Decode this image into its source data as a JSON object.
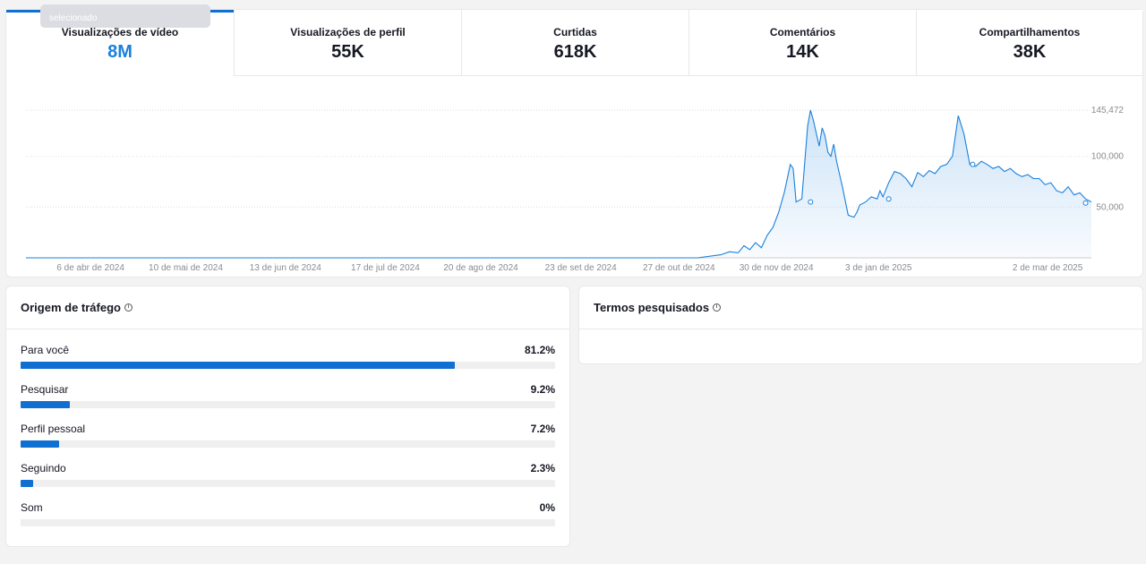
{
  "tooltip_fragment": "selecionado",
  "metrics": [
    {
      "label": "Visualizações de vídeo",
      "value": "8M",
      "active": true
    },
    {
      "label": "Visualizações de perfil",
      "value": "55K",
      "active": false
    },
    {
      "label": "Curtidas",
      "value": "618K",
      "active": false
    },
    {
      "label": "Comentários",
      "value": "14K",
      "active": false
    },
    {
      "label": "Compartilhamentos",
      "value": "38K",
      "active": false
    }
  ],
  "chart_data": {
    "type": "area",
    "title": "",
    "y_ticks": [
      145472,
      100000,
      50000
    ],
    "y_tick_labels": [
      "145,472",
      "100,000",
      "50,000"
    ],
    "ylim": [
      0,
      145472
    ],
    "x_tick_labels": [
      "6 de abr de 2024",
      "10 de mai de 2024",
      "13 de jun de 2024",
      "17 de jul de 2024",
      "20 de ago de 2024",
      "23 de set de 2024",
      "27 de out de 2024",
      "30 de nov de 2024",
      "3 de jan de 2025",
      "2 de mar de 2025"
    ],
    "x_tick_days": [
      34,
      68,
      102,
      136,
      170,
      204,
      238,
      272,
      306,
      365
    ],
    "x_range_days": [
      0,
      368
    ],
    "grid": true,
    "color": "#1a80dd",
    "series": [
      {
        "x": [
          0,
          232,
          240,
          243,
          246,
          248,
          250,
          252,
          254,
          256,
          258,
          260,
          262,
          264,
          265,
          266,
          268,
          270,
          271,
          272,
          274,
          275,
          276,
          277,
          278,
          279,
          280,
          282,
          284,
          286,
          287,
          288,
          290,
          292,
          294,
          295,
          296,
          298,
          300,
          302,
          304,
          306,
          308,
          310,
          312,
          314,
          316,
          318,
          320,
          322,
          324,
          326,
          328,
          330,
          332,
          334,
          336,
          338,
          340,
          342,
          344,
          346,
          348,
          350,
          352,
          354,
          356,
          358,
          360,
          362,
          364,
          366,
          368
        ],
        "y": [
          0,
          0,
          3000,
          6000,
          5000,
          12000,
          8000,
          15000,
          10000,
          22000,
          30000,
          45000,
          65000,
          92000,
          88000,
          55000,
          58000,
          130000,
          145472,
          135000,
          110000,
          128000,
          120000,
          104000,
          100000,
          112000,
          95000,
          70000,
          42000,
          40000,
          45000,
          52000,
          55000,
          60000,
          58000,
          66000,
          60000,
          74000,
          85000,
          83000,
          78000,
          70000,
          84000,
          80000,
          86000,
          83000,
          90000,
          92000,
          100000,
          140000,
          122000,
          92000,
          90000,
          95000,
          92000,
          88000,
          90000,
          85000,
          88000,
          83000,
          80000,
          82000,
          78000,
          78000,
          72000,
          74000,
          66000,
          64000,
          70000,
          62000,
          64000,
          58000,
          55000
        ],
        "markers": [
          {
            "x": 271,
            "y": 55000
          },
          {
            "x": 298,
            "y": 58000
          },
          {
            "x": 327,
            "y": 92000
          },
          {
            "x": 366,
            "y": 54000
          }
        ]
      }
    ]
  },
  "traffic": {
    "title": "Origem de tráfego",
    "info_icon": "info-icon",
    "items": [
      {
        "label": "Para você",
        "value": "81.2%",
        "fraction": 0.812
      },
      {
        "label": "Pesquisar",
        "value": "9.2%",
        "fraction": 0.092
      },
      {
        "label": "Perfil pessoal",
        "value": "7.2%",
        "fraction": 0.072
      },
      {
        "label": "Seguindo",
        "value": "2.3%",
        "fraction": 0.023
      },
      {
        "label": "Som",
        "value": "0%",
        "fraction": 0.0
      }
    ]
  },
  "terms": {
    "title": "Termos pesquisados",
    "info_icon": "info-icon"
  }
}
